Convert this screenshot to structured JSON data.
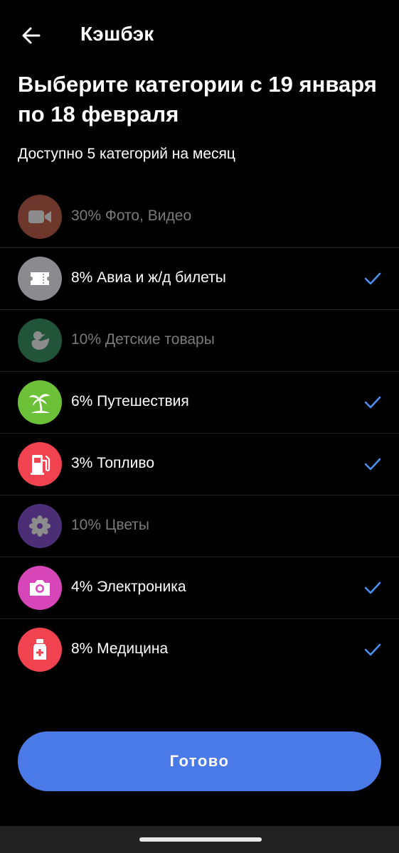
{
  "header": {
    "title": "Кэшбэк",
    "back_icon": "arrow-left-icon"
  },
  "page_title": "Выберите категории с 19 января по 18 февраля",
  "subtitle": "Доступно 5 категорий на месяц",
  "categories": [
    {
      "label": "30% Фото, Видео",
      "icon": "video-camera-icon",
      "color": "#c9654f",
      "selected": false,
      "enabled": false
    },
    {
      "label": "8% Авиа и ж/д билеты",
      "icon": "ticket-icon",
      "color": "#8a8a8f",
      "selected": true,
      "enabled": true
    },
    {
      "label": "10% Детские товары",
      "icon": "duck-icon",
      "color": "#3f9a6a",
      "selected": false,
      "enabled": false
    },
    {
      "label": "6% Путешествия",
      "icon": "palm-tree-icon",
      "color": "#6cc138",
      "selected": true,
      "enabled": true
    },
    {
      "label": "3% Топливо",
      "icon": "fuel-pump-icon",
      "color": "#f0424f",
      "selected": true,
      "enabled": true
    },
    {
      "label": "10% Цветы",
      "icon": "flower-icon",
      "color": "#8b55d8",
      "selected": false,
      "enabled": false
    },
    {
      "label": "4% Электроника",
      "icon": "camera-icon",
      "color": "#d746b8",
      "selected": true,
      "enabled": true
    },
    {
      "label": "8% Медицина",
      "icon": "medicine-bottle-icon",
      "color": "#f0424f",
      "selected": true,
      "enabled": true
    }
  ],
  "check_color": "#4a90f0",
  "done_button": {
    "label": "Готово",
    "color": "#4a7ae8"
  }
}
